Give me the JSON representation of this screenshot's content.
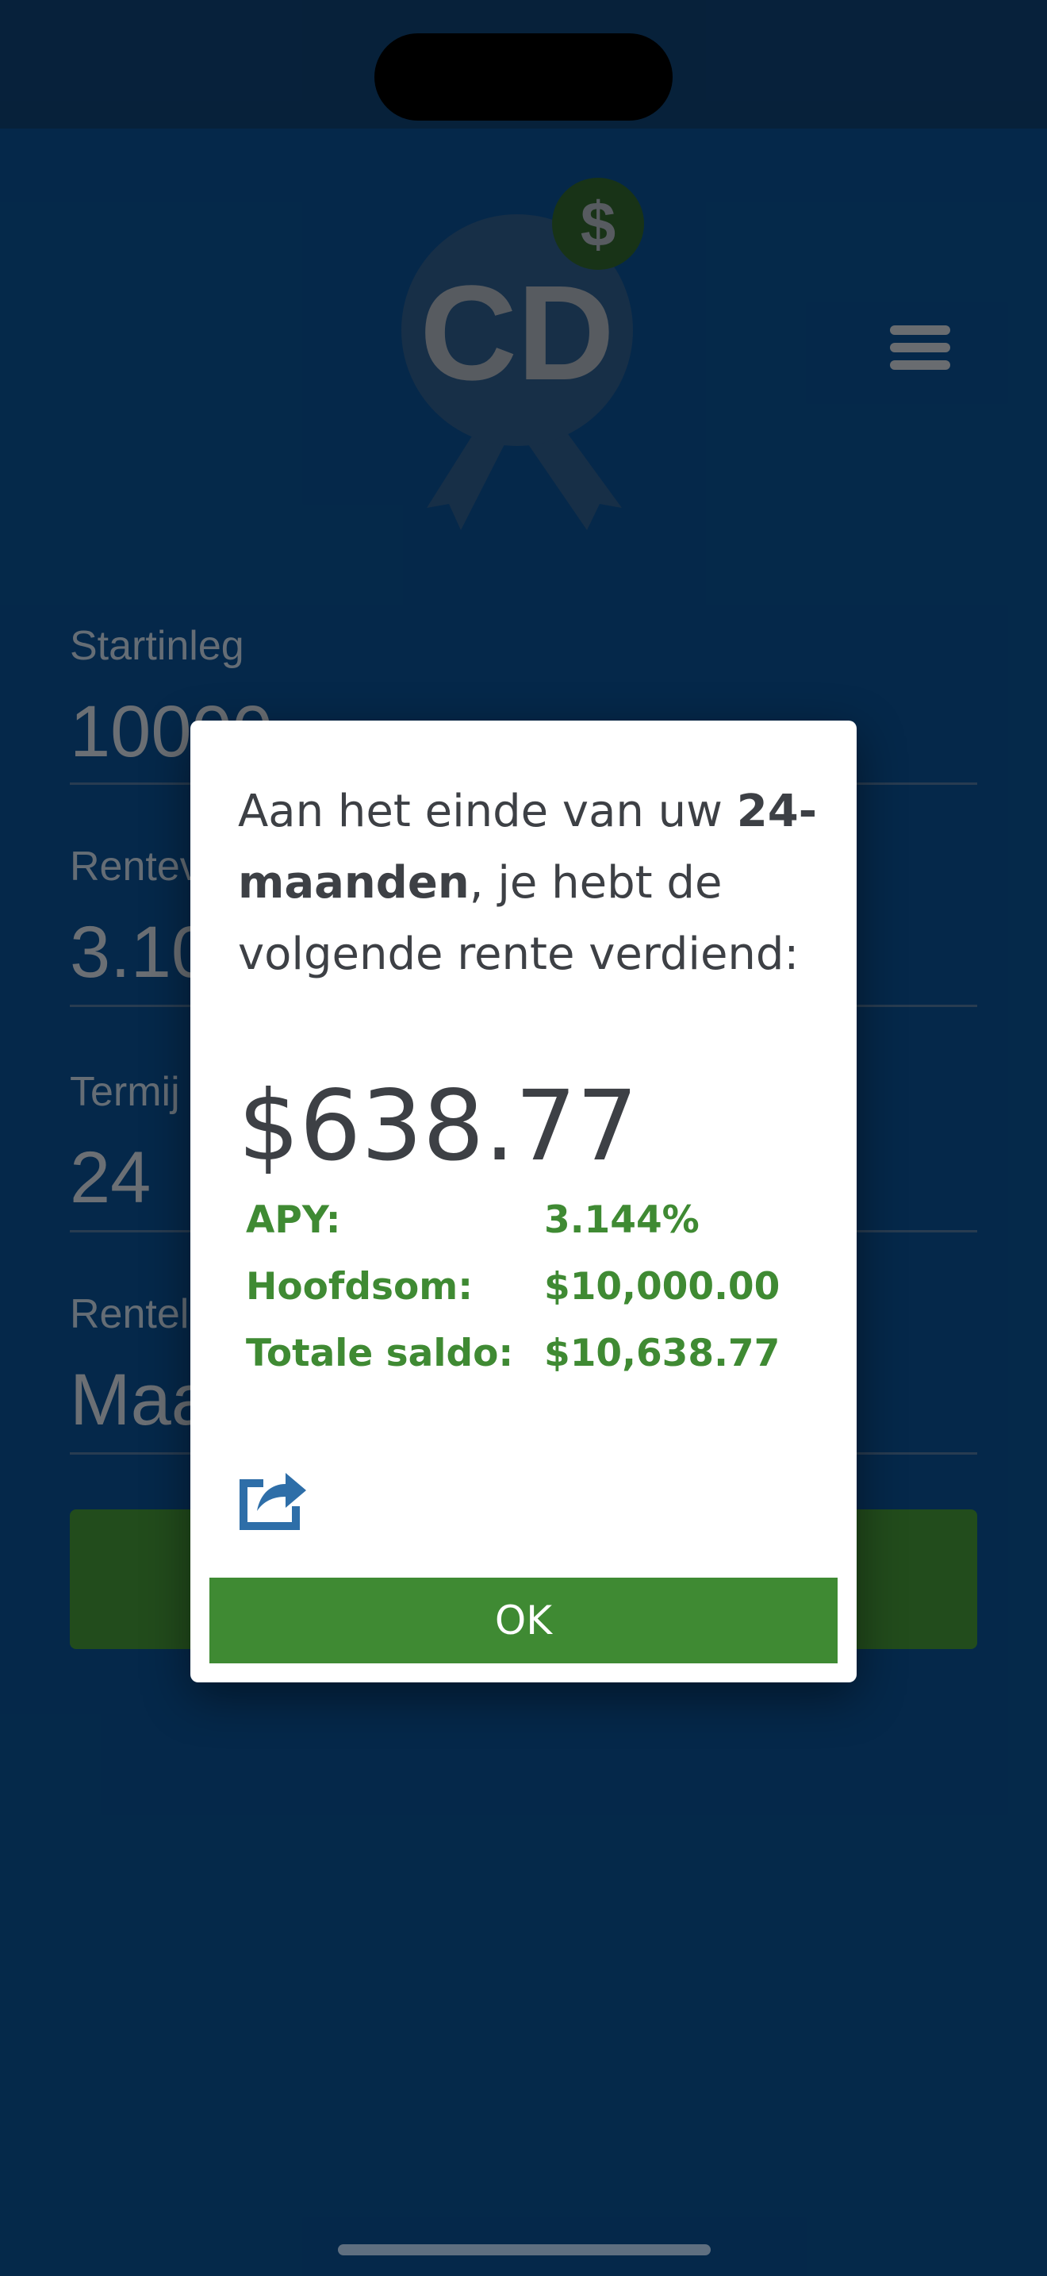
{
  "app": {
    "logo_text": "CD",
    "logo_badge": "$",
    "colors": {
      "background": "#0a4a87",
      "accent": "#3f8a33",
      "dialog": "#ffffff"
    }
  },
  "form": {
    "fields": [
      {
        "label": "Startinleg",
        "value": "10000"
      },
      {
        "label": "Rentev",
        "value": "3.10"
      },
      {
        "label": "Termij",
        "value": "24"
      },
      {
        "label": "Rentel",
        "value": "Maa"
      }
    ]
  },
  "dialog": {
    "message_part1": "Aan het einde van uw ",
    "message_bold": "24-maanden",
    "message_part2": ", je hebt de volgende rente verdiend:",
    "amount": "$638.77",
    "stats": [
      {
        "label": "APY:",
        "value": "3.144%"
      },
      {
        "label": "Hoofdsom:",
        "value": "$10,000.00"
      },
      {
        "label": "Totale saldo:",
        "value": "$10,638.77"
      }
    ],
    "share_icon": "share-icon",
    "ok_label": "OK"
  }
}
